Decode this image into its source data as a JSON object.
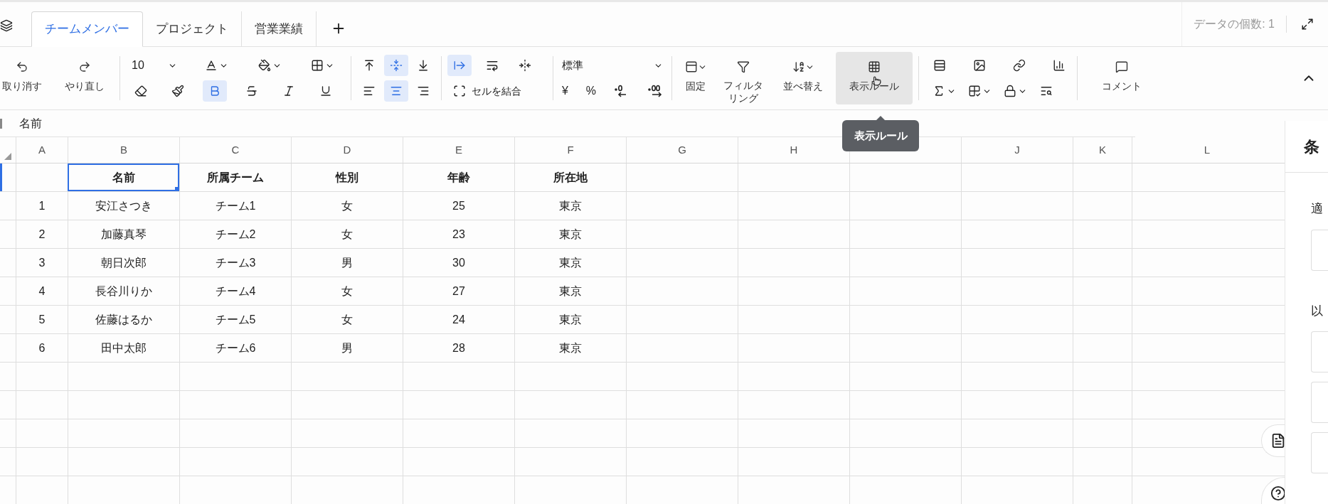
{
  "sheet_tabs": [
    {
      "label": "チームメンバー",
      "selected": true
    },
    {
      "label": "プロジェクト",
      "selected": false
    },
    {
      "label": "営業業績",
      "selected": false
    }
  ],
  "data_count": "データの個数: 1",
  "toolbar": {
    "undo_label": "取り消す",
    "redo_label": "やり直し",
    "font_size": "10",
    "bold": {
      "selected": true
    },
    "strike": {
      "selected": false
    },
    "italic": {
      "selected": false
    },
    "underline": {
      "selected": false
    },
    "vertical_align": [
      {
        "selected": false
      },
      {
        "selected": true
      },
      {
        "selected": false
      }
    ],
    "horizontal_align": [
      {
        "selected": false
      },
      {
        "selected": true
      },
      {
        "selected": false
      }
    ],
    "text_wrap": [
      {
        "selected": true
      },
      {
        "selected": false
      },
      {
        "selected": false
      }
    ],
    "merge_label": "セルを結合",
    "number_format": "標準",
    "currency_symbol": "¥",
    "percent_symbol": "%",
    "freeze_label": "固定",
    "filter_label": "フィルタリング",
    "sort_label": "並べ替え",
    "rule_button": {
      "label": "表示ルール",
      "hovered": true
    },
    "comment_label": "コメント"
  },
  "formula_bar": {
    "value": "名前"
  },
  "grid": {
    "columns": [
      "A",
      "B",
      "C",
      "D",
      "E",
      "F",
      "G",
      "H",
      null,
      "J",
      "K",
      "L"
    ],
    "rows": [
      {
        "kind": "header",
        "values": [
          {
            "text": "名前",
            "selected": true
          },
          {
            "text": "所属チーム",
            "selected": false
          },
          {
            "text": "性別",
            "selected": false
          },
          {
            "text": "年齢",
            "selected": false
          },
          {
            "text": "所在地",
            "selected": false
          }
        ]
      },
      {
        "kind": "data",
        "number": "1",
        "values": [
          {
            "text": "安江さつき",
            "selected": false
          },
          {
            "text": "チーム1",
            "selected": false
          },
          {
            "text": "女",
            "selected": false
          },
          {
            "text": "25",
            "selected": false
          },
          {
            "text": "東京",
            "selected": false
          }
        ]
      },
      {
        "kind": "data",
        "number": "2",
        "values": [
          {
            "text": "加藤真琴",
            "selected": false
          },
          {
            "text": "チーム2",
            "selected": false
          },
          {
            "text": "女",
            "selected": false
          },
          {
            "text": "23",
            "selected": false
          },
          {
            "text": "東京",
            "selected": false
          }
        ]
      },
      {
        "kind": "data",
        "number": "3",
        "values": [
          {
            "text": "朝日次郎",
            "selected": false
          },
          {
            "text": "チーム3",
            "selected": false
          },
          {
            "text": "男",
            "selected": false
          },
          {
            "text": "30",
            "selected": false
          },
          {
            "text": "東京",
            "selected": false
          }
        ]
      },
      {
        "kind": "data",
        "number": "4",
        "values": [
          {
            "text": "長谷川りか",
            "selected": false
          },
          {
            "text": "チーム4",
            "selected": false
          },
          {
            "text": "女",
            "selected": false
          },
          {
            "text": "27",
            "selected": false
          },
          {
            "text": "東京",
            "selected": false
          }
        ]
      },
      {
        "kind": "data",
        "number": "5",
        "values": [
          {
            "text": "佐藤はるか",
            "selected": false
          },
          {
            "text": "チーム5",
            "selected": false
          },
          {
            "text": "女",
            "selected": false
          },
          {
            "text": "24",
            "selected": false
          },
          {
            "text": "東京",
            "selected": false
          }
        ]
      },
      {
        "kind": "data",
        "number": "6",
        "values": [
          {
            "text": "田中太郎",
            "selected": false
          },
          {
            "text": "チーム6",
            "selected": false
          },
          {
            "text": "男",
            "selected": false
          },
          {
            "text": "28",
            "selected": false
          },
          {
            "text": "東京",
            "selected": false
          }
        ]
      }
    ]
  },
  "tooltip": "表示ルール",
  "side_panel": {
    "title": "条",
    "labels": [
      "適",
      "以"
    ]
  }
}
